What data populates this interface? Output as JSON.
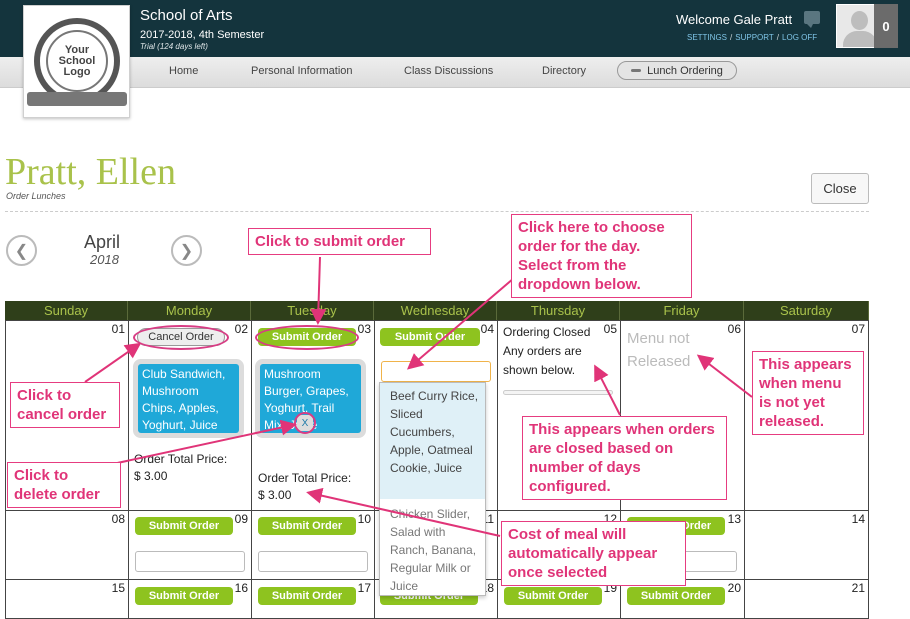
{
  "header": {
    "school_name": "School of Arts",
    "semester": "2017-2018, 4th Semester",
    "trial": "Trial (124 days left)",
    "welcome": "Welcome Gale Pratt",
    "links": [
      "SETTINGS",
      "SUPPORT",
      "LOG OFF"
    ],
    "notification_count": "0",
    "logo_text": "Your School Logo"
  },
  "nav": {
    "items": [
      "Home",
      "Personal Information",
      "Class Discussions",
      "Directory"
    ],
    "active": "Lunch Ordering"
  },
  "page": {
    "student_name": "Pratt, Ellen",
    "subtitle": "Order Lunches",
    "close_label": "Close",
    "month": "April",
    "year": "2018"
  },
  "calendar": {
    "days": [
      "Sunday",
      "Monday",
      "Tuesday",
      "Wednesday",
      "Thursday",
      "Friday",
      "Saturday"
    ],
    "week1": [
      "01",
      "02",
      "03",
      "04",
      "05",
      "06",
      "07"
    ],
    "week2": [
      "08",
      "09",
      "10",
      "11",
      "12",
      "13",
      "14"
    ],
    "week3": [
      "15",
      "16",
      "17",
      "18",
      "19",
      "20",
      "21"
    ],
    "submit_label": "Submit Order",
    "cancel_label": "Cancel Order",
    "monday_meal": "Club Sandwich, Mushroom Chips, Apples, Yoghurt, Juice",
    "tuesday_meal": "Mushroom Burger, Grapes, Yoghurt, Trail Mix, Juice",
    "remove_label": "X",
    "total_label": "Order Total Price:",
    "total_value": "$ 3.00",
    "closed_line1": "Ordering Closed",
    "closed_line2": "Any orders are shown below.",
    "menu_not_released": "Menu not Released",
    "dropdown_options": [
      "Beef Curry Rice, Sliced Cucumbers, Apple, Oatmeal Cookie, Juice",
      "Chicken Slider, Salad with Ranch, Banana, Regular Milk or Juice"
    ]
  },
  "callouts": {
    "submit": "Click to submit order",
    "choose": "Click here to choose order for the day. Select from the dropdown below.",
    "cancel": "Click to cancel order",
    "delete": "Click to delete order",
    "closed": "This appears when orders are closed based on number of days configured.",
    "not_released": "This appears when menu is not yet released.",
    "cost": "Cost of meal will automatically appear once selected"
  },
  "colors": {
    "topbar": "#14343d",
    "accent_green": "#a9c24b",
    "button_green": "#8ec31f",
    "meal_blue": "#1fa8d8",
    "callout_pink": "#e03478"
  }
}
